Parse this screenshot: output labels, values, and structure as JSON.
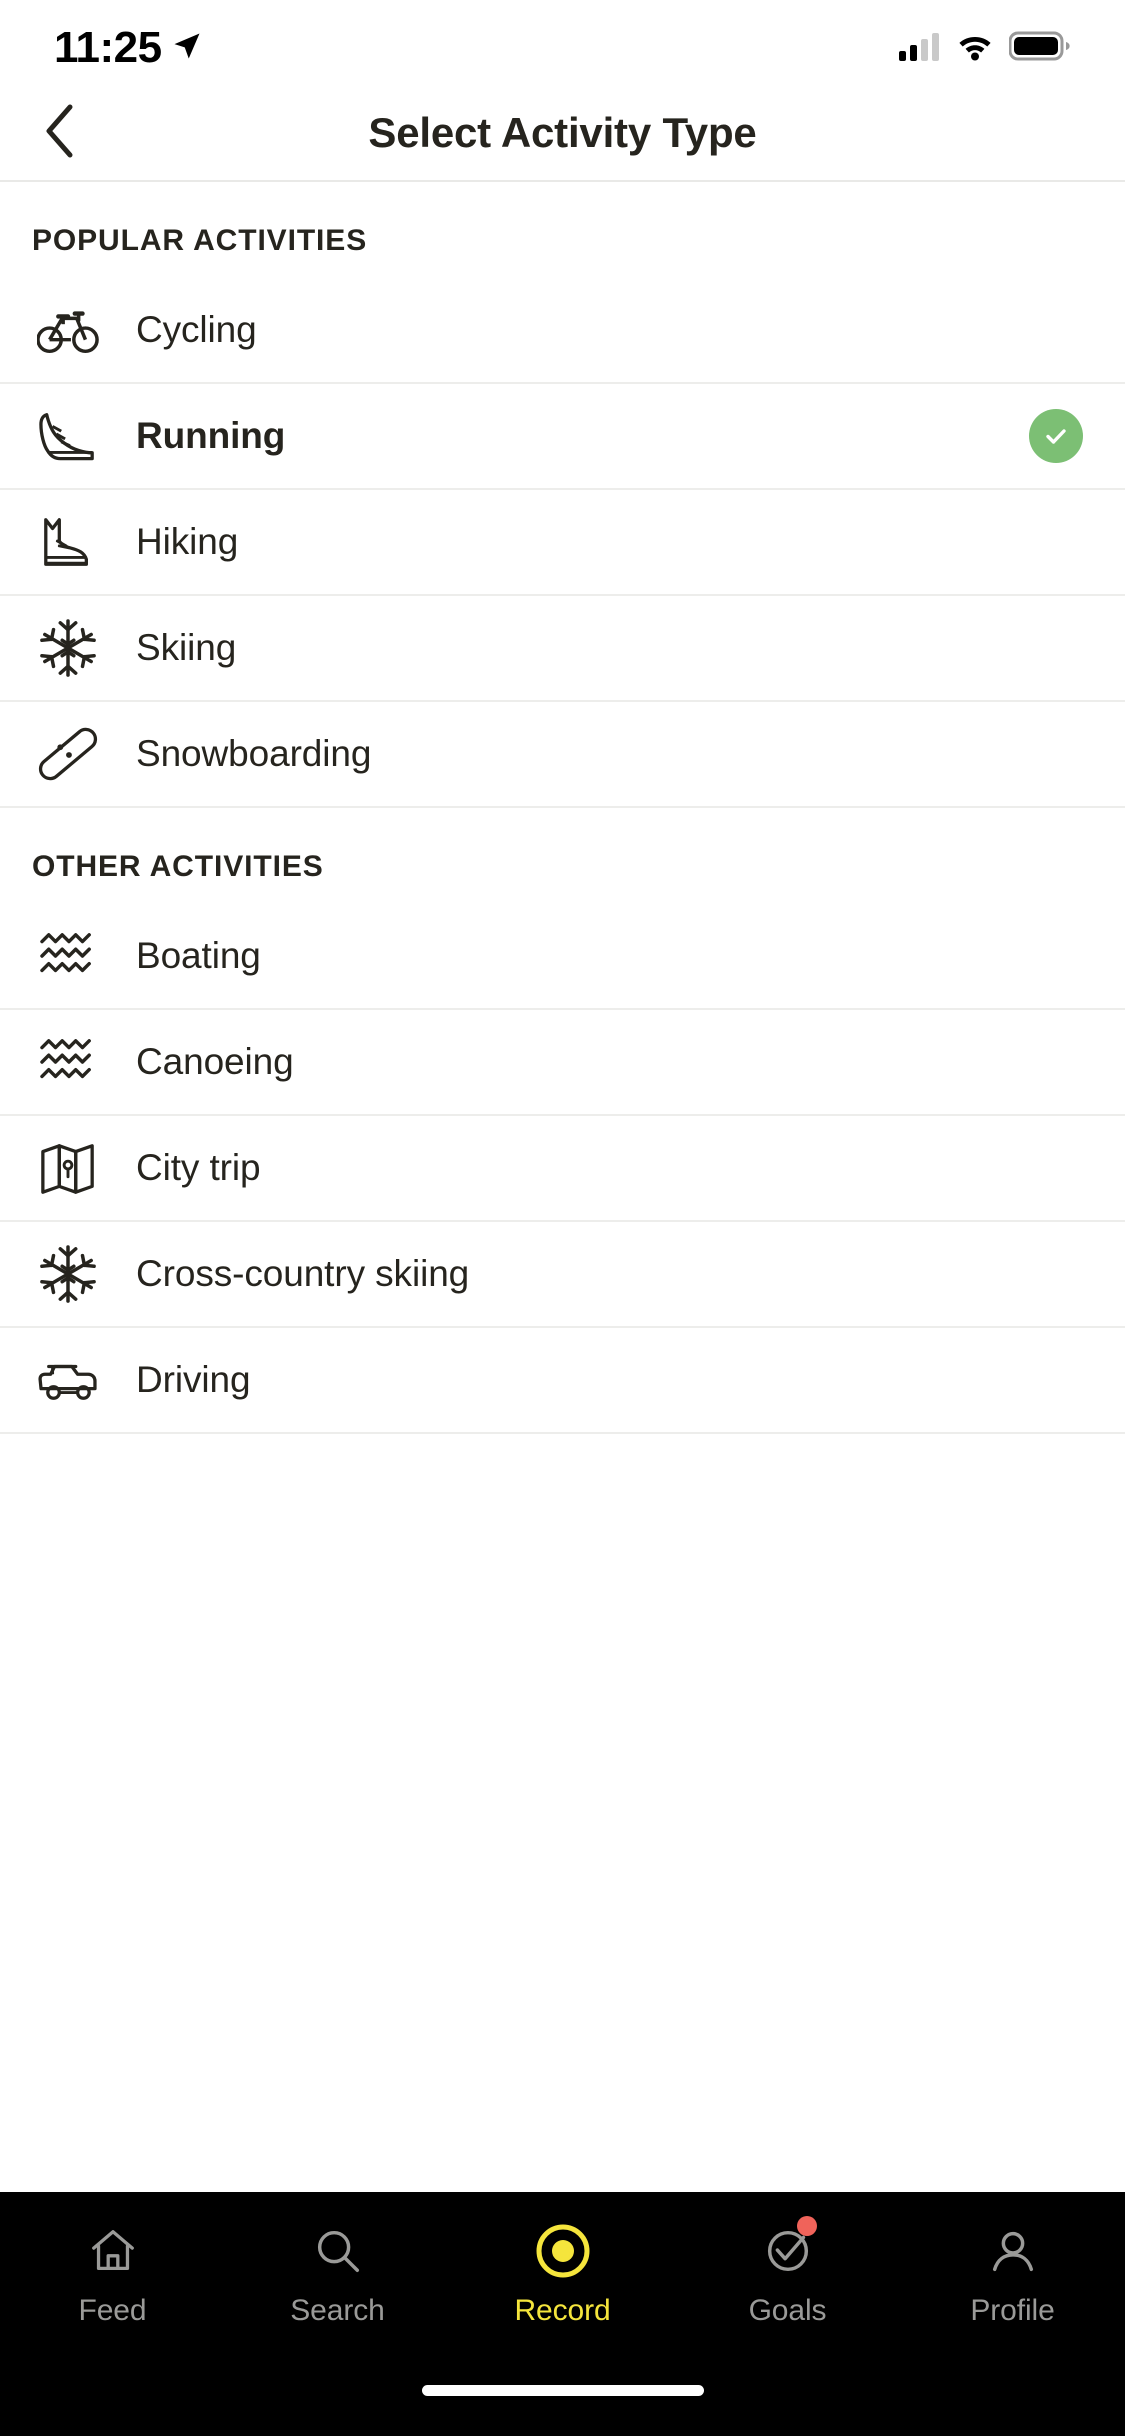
{
  "status_bar": {
    "time": "11:25",
    "location_icon": "location-arrow-icon",
    "cellular_icon": "cellular-signal-icon",
    "wifi_icon": "wifi-icon",
    "battery_icon": "battery-full-icon"
  },
  "header": {
    "back_icon": "chevron-left-icon",
    "title": "Select Activity Type"
  },
  "sections": [
    {
      "title": "POPULAR ACTIVITIES",
      "rows": [
        {
          "label": "Cycling",
          "icon": "bicycle-icon",
          "selected": false
        },
        {
          "label": "Running",
          "icon": "running-shoe-icon",
          "selected": true
        },
        {
          "label": "Hiking",
          "icon": "hiking-boot-icon",
          "selected": false
        },
        {
          "label": "Skiing",
          "icon": "snowflake-icon",
          "selected": false
        },
        {
          "label": "Snowboarding",
          "icon": "snowboard-icon",
          "selected": false
        }
      ]
    },
    {
      "title": "OTHER ACTIVITIES",
      "rows": [
        {
          "label": "Boating",
          "icon": "waves-icon",
          "selected": false
        },
        {
          "label": "Canoeing",
          "icon": "waves-icon",
          "selected": false
        },
        {
          "label": "City trip",
          "icon": "folded-map-icon",
          "selected": false
        },
        {
          "label": "Cross-country skiing",
          "icon": "snowflake-icon",
          "selected": false
        },
        {
          "label": "Driving",
          "icon": "car-icon",
          "selected": false
        }
      ]
    }
  ],
  "selected_check_icon": "check-circle-icon",
  "tab_bar": {
    "items": [
      {
        "label": "Feed",
        "icon": "home-icon",
        "active": false,
        "badge": false
      },
      {
        "label": "Search",
        "icon": "search-icon",
        "active": false,
        "badge": false
      },
      {
        "label": "Record",
        "icon": "record-circle-icon",
        "active": true,
        "badge": false
      },
      {
        "label": "Goals",
        "icon": "target-check-icon",
        "active": false,
        "badge": true
      },
      {
        "label": "Profile",
        "icon": "person-icon",
        "active": false,
        "badge": false
      }
    ]
  },
  "colors": {
    "accent_yellow": "#F5E53C",
    "check_green": "#7CBF74",
    "badge_red": "#F0635A",
    "text_dark": "#26241E",
    "tab_inactive": "#9A9A98",
    "tab_bg": "#000000",
    "divider": "#EDEDEB"
  },
  "home_indicator": "home-indicator"
}
